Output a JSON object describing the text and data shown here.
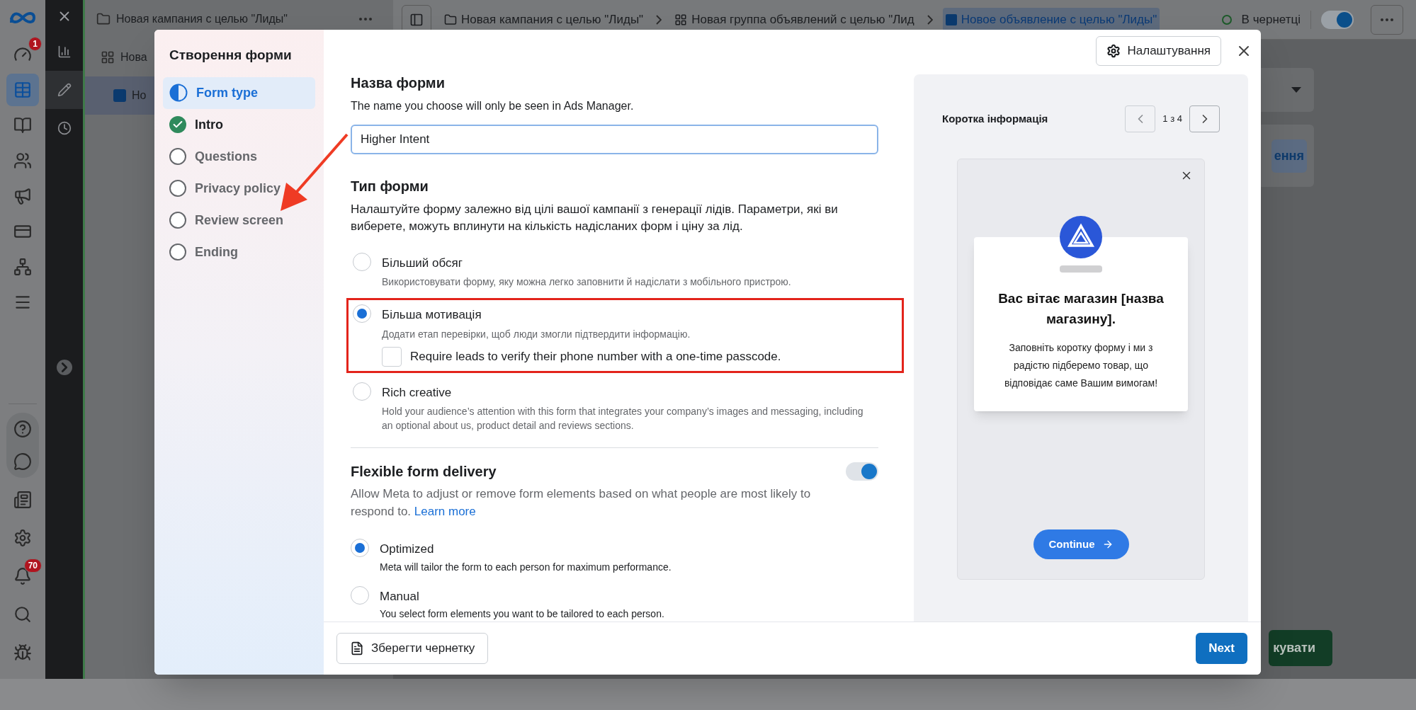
{
  "rail": {
    "items": [
      {
        "selected": false,
        "badge": "1"
      },
      {
        "selected": true
      },
      {
        "selected": false
      },
      {
        "selected": false
      },
      {
        "selected": false
      },
      {
        "selected": false
      },
      {
        "selected": false
      },
      {
        "selected": false
      }
    ],
    "bottom_items": [
      {
        "selected": false
      },
      {
        "selected": false
      },
      {
        "selected": false
      },
      {
        "selected": false
      },
      {
        "selected": false,
        "badge": "70"
      },
      {
        "selected": false
      },
      {
        "selected": false
      }
    ]
  },
  "tool_sidebar": {
    "items": [
      {
        "selected": false
      },
      {
        "selected": true
      },
      {
        "selected": false
      }
    ]
  },
  "tree": [
    {
      "label": "Новая кампания с целью \"Лиды\"",
      "selected": false
    },
    {
      "label": "Нова",
      "selected": false
    },
    {
      "label": "Но",
      "selected": true
    }
  ],
  "breadcrumbs": [
    {
      "label": "Новая кампания с целью \"Лиды\"",
      "selected": false
    },
    {
      "label": "Новая группа объявлений с целью \"Лид",
      "selected": false
    },
    {
      "label": "Новое объявление с целью \"Лиды\"",
      "selected": true
    }
  ],
  "status": {
    "label": "В чернетці"
  },
  "publish_toggle": {
    "on": true
  },
  "background": {
    "button_text": "ення",
    "action_text": "кувати"
  },
  "dialog": {
    "title": "Створення форми",
    "steps": [
      {
        "label": "Form type",
        "kind": "current"
      },
      {
        "label": "Intro",
        "kind": "done"
      },
      {
        "label": "Questions",
        "kind": "todo"
      },
      {
        "label": "Privacy policy",
        "kind": "todo"
      },
      {
        "label": "Review screen",
        "kind": "todo"
      },
      {
        "label": "Ending",
        "kind": "todo"
      }
    ],
    "settings_button": "Налаштування",
    "form_name": {
      "heading": "Назва форми",
      "hint": "The name you choose will only be seen in Ads Manager.",
      "value": "Higher Intent"
    },
    "form_type": {
      "heading": "Тип форми",
      "description": "Налаштуйте форму залежно від цілі вашої кампанії з генерації лідів. Параметри, які ви виберете, можуть вплинути на кількість надісланих форм і ціну за лід.",
      "options": [
        {
          "label": "Більший обсяг",
          "description": "Використовувати форму, яку можна легко заповнити й надіслати з мобільного пристрою.",
          "selected": false
        },
        {
          "label": "Більша мотивація",
          "description": "Додати етап перевірки, щоб люди змогли підтвердити інформацію.",
          "selected": true,
          "annotated": true,
          "checkbox": {
            "label": "Require leads to verify their phone number with a one-time passcode.",
            "checked": false
          }
        },
        {
          "label": "Rich creative",
          "description": "Hold your audience’s attention with this form that integrates your company’s images and messaging, including an optional about us, product detail and reviews sections.",
          "selected": false
        }
      ]
    },
    "flexible": {
      "heading": "Flexible form delivery",
      "description": "Allow Meta to adjust or remove form elements based on what people are most likely to respond to.",
      "link": "Learn more",
      "on": true,
      "options": [
        {
          "label": "Optimized",
          "description": "Meta will tailor the form to each person for maximum performance.",
          "selected": true
        },
        {
          "label": "Manual",
          "description": "You select form elements you want to be tailored to each person.",
          "selected": false
        }
      ]
    },
    "preview": {
      "title": "Коротка інформація",
      "pager": "1 з 4",
      "heading": "Вас вітає магазин [назва магазину].",
      "body": "Заповніть коротку форму і ми з радістю підберемо товар, що відповідає саме Вашим вимогам!",
      "button": "Continue"
    },
    "save_button": "Зберегти чернетку",
    "next_button": "Next"
  }
}
